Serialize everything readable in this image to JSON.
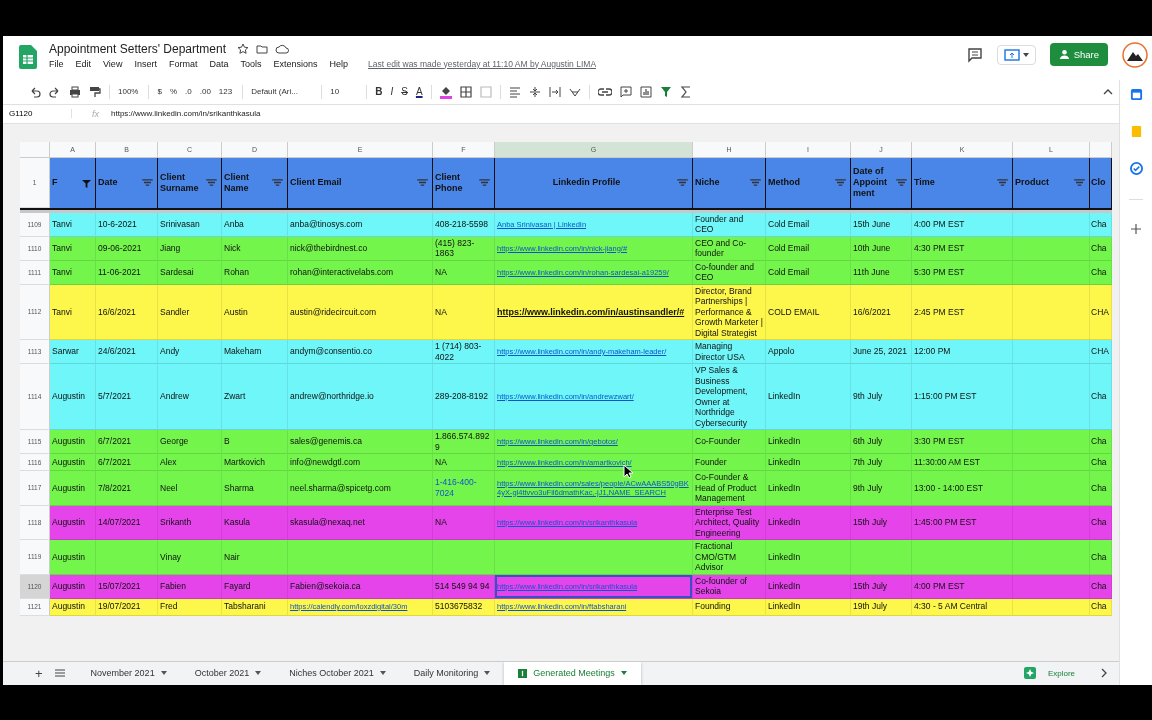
{
  "document": {
    "title": "Appointment Setters' Department",
    "last_edit": "Last edit was made yesterday at 11:10 AM by Augustin LIMA"
  },
  "menu": [
    "File",
    "Edit",
    "View",
    "Insert",
    "Format",
    "Data",
    "Tools",
    "Extensions",
    "Help"
  ],
  "share_button": "Share",
  "toolbar": {
    "zoom": "100%",
    "currency": "$",
    "percent": "%",
    "decrease_decimals": ".0",
    "increase_decimals": ".00",
    "number_format": "123",
    "font": "Default (Ari...",
    "font_size": "10",
    "bold": "B",
    "italic": "I",
    "strikethrough": "S",
    "text_color": "A"
  },
  "formula_bar": {
    "cell": "G1120",
    "fx": "fx",
    "value": "https://www.linkedin.com/in/srikanthkasula"
  },
  "header_row": "1",
  "columns": [
    {
      "letter": "A",
      "header": "F",
      "filter_active": true,
      "selected": false
    },
    {
      "letter": "B",
      "header": "Date",
      "filter_active": false,
      "selected": false
    },
    {
      "letter": "C",
      "header": "Client Surname",
      "filter_active": false,
      "selected": false
    },
    {
      "letter": "D",
      "header": "Client Name",
      "filter_active": false,
      "selected": false
    },
    {
      "letter": "E",
      "header": "Client Email",
      "filter_active": false,
      "selected": false
    },
    {
      "letter": "F",
      "header": "Client Phone",
      "filter_active": false,
      "selected": false
    },
    {
      "letter": "G",
      "header": "Linkedin Profile",
      "filter_active": false,
      "selected": true
    },
    {
      "letter": "H",
      "header": "Niche",
      "filter_active": false,
      "selected": false
    },
    {
      "letter": "I",
      "header": "Method",
      "filter_active": false,
      "selected": false
    },
    {
      "letter": "J",
      "header": "Date of Appoint ment",
      "filter_active": false,
      "selected": false
    },
    {
      "letter": "K",
      "header": "Time",
      "filter_active": false,
      "selected": false
    },
    {
      "letter": "L",
      "header": "Product",
      "filter_active": false,
      "selected": false
    },
    {
      "header": "Clo"
    }
  ],
  "rows": [
    {
      "number": "1109",
      "color": "#6ff6f9",
      "selected": false,
      "cells": [
        "Tanvi",
        "10-6-2021",
        "Srinivasan",
        "Anba",
        "anba@tinosys.com",
        "408-218-5598",
        {
          "text": "Anba Srinivasan | LinkedIn",
          "kind": "link"
        },
        "Founder and CEO",
        "Cold Email",
        "15th June",
        "4:00 PM EST",
        null,
        "Cha"
      ]
    },
    {
      "number": "1110",
      "color": "#74f54c",
      "selected": false,
      "cells": [
        "Tanvi",
        "09-06-2021",
        "Jiang",
        "Nick",
        "nick@thebirdnest.co",
        "(415) 823-1863",
        {
          "text": "https://www.linkedin.com/in/nick-jiang/#",
          "kind": "link"
        },
        "CEO and Co-founder",
        "Cold Email",
        "10th June",
        "4:30 PM EST",
        null,
        "Cha"
      ]
    },
    {
      "number": "1111",
      "color": "#74f54c",
      "selected": false,
      "cells": [
        "Tanvi",
        "11-06-2021",
        "Sardesai",
        "Rohan",
        "rohan@interactivelabs.com",
        "NA",
        {
          "text": "https://www.linkedin.com/in/rohan-sardesai-a19259/",
          "kind": "link"
        },
        "Co-founder and CEO",
        "Cold Email",
        "11th June",
        "5:30 PM EST",
        null,
        "Cha"
      ]
    },
    {
      "number": "1112",
      "color": "#fdf64b",
      "selected": false,
      "cells": [
        "Tanvi",
        "16/6/2021",
        "Sandler",
        "Austin",
        "austin@ridecircuit.com",
        "NA",
        {
          "text": "https://www.linkedin.com/in/austinsandler/#",
          "kind": "bold-link"
        },
        "Director, Brand Partnerships | Performance & Growth Marketer | Digital Strategist",
        "COLD EMAIL",
        "16/6/2021",
        "2:45 PM EST",
        null,
        "CHA"
      ]
    },
    {
      "number": "1113",
      "color": "#6ff6f9",
      "selected": false,
      "cells": [
        "Sarwar",
        "24/6/2021",
        "Andy",
        "Makeham",
        "andym@consentio.co",
        "1 (714) 803-4022",
        {
          "text": "https://www.linkedin.com/in/andy-makeham-leader/",
          "kind": "link"
        },
        "Managing Director USA",
        "Appolo",
        "June 25, 2021",
        "12:00 PM",
        null,
        "CHA"
      ]
    },
    {
      "number": "1114",
      "color": "#6ff6f9",
      "selected": false,
      "cells": [
        "Augustin",
        "5/7/2021",
        "Andrew",
        "Zwart",
        "andrew@northridge.io",
        "289-208-8192",
        {
          "text": "https://www.linkedin.com/in/andrewzwart/",
          "kind": "link"
        },
        "VP Sales & Business Development, Owner at Northridge Cybersecurity",
        "LinkedIn",
        "9th July",
        "1:15:00 PM EST",
        null,
        "Cha"
      ]
    },
    {
      "number": "1115",
      "color": "#74f54c",
      "selected": false,
      "cells": [
        "Augustin",
        "6/7/2021",
        "George",
        "B",
        "sales@genemis.ca",
        "1.866.574.8929",
        {
          "text": "https://www.linkedin.com/in/gebotos/",
          "kind": "link"
        },
        "Co-Founder",
        "LinkedIn",
        "6th July",
        "3:30 PM EST",
        null,
        "Cha"
      ]
    },
    {
      "number": "1116",
      "color": "#74f54c",
      "selected": false,
      "cells": [
        "Augustin",
        "6/7/2021",
        "Alex",
        "Martkovich",
        "info@newdgtl.com",
        "NA",
        {
          "text": "https://www.linkedin.com/in/amartkovich/",
          "kind": "link"
        },
        "Founder",
        "LinkedIn",
        "7th July",
        "11:30:00 AM EST",
        null,
        "Cha"
      ]
    },
    {
      "number": "1117",
      "color": "#74f54c",
      "selected": false,
      "cells": [
        "Augustin",
        "7/8/2021",
        "Neel",
        "Sharma",
        "neel.sharma@spicetg.com",
        {
          "text": "1-416-400-7024",
          "kind": "phone-link"
        },
        {
          "text": "https://www.linkedin.com/sales/people/ACwAAABS50gBK4yX-gl4ttvvo3uFil6dmathKac,-jJ1,NAME_SEARCH",
          "kind": "link"
        },
        "Co-Founder & Head of Product Management",
        "LinkedIn",
        "9th July",
        "13:00 - 14:00 EST",
        null,
        "Cha"
      ]
    },
    {
      "number": "1118",
      "color": "#e444ea",
      "selected": false,
      "cells": [
        "Augustin",
        "14/07/2021",
        "Srikanth",
        "Kasula",
        "skasula@nexaq.net",
        "NA",
        {
          "text": "https://www.linkedin.com/in/srikanthkasula",
          "kind": "link"
        },
        "Enterprise Test Architect, Quality Engineering",
        "LinkedIn",
        "15th July",
        "1:45:00 PM EST",
        null,
        "Cha"
      ]
    },
    {
      "number": "1119",
      "color": "#74f54c",
      "selected": false,
      "cells": [
        "Augustin",
        null,
        "Vinay",
        "Nair",
        null,
        null,
        null,
        "Fractional CMO/GTM Advisor",
        "LinkedIn",
        null,
        null,
        null,
        "Cha"
      ]
    },
    {
      "number": "1120",
      "color": "#e444ea",
      "selected": true,
      "cells": [
        "Augustin",
        "15/07/2021",
        "Fabien",
        "Fayard",
        "Fabien@sekoia.ca",
        "514 549 94 94",
        {
          "text": "https://www.linkedin.com/in/srikanthkasula",
          "kind": "link"
        },
        "Co-founder of Sekoia",
        "LinkedIn",
        "15th July",
        "4:00 PM EST",
        null,
        "Cha"
      ]
    },
    {
      "number": "1121",
      "color": "#fdf64b",
      "selected": false,
      "cells": [
        "Augustin",
        "19/07/2021",
        "Fred",
        "Tabsharani",
        {
          "text": "https://calendly.com/loxzdigital/30m",
          "kind": "link"
        },
        "5103675832",
        {
          "text": "https://www.linkedin.com/in/ftabsharani",
          "kind": "link"
        },
        "Founding",
        "LinkedIn",
        "19th July",
        "4:30 - 5 AM Central",
        null,
        "Cha"
      ]
    }
  ],
  "sheet_tabs": [
    {
      "label": "November 2021",
      "selected": false
    },
    {
      "label": "October 2021",
      "selected": false
    },
    {
      "label": "Niches October 2021",
      "selected": false
    },
    {
      "label": "Daily Monitoring",
      "selected": false
    },
    {
      "label": "Generated Meetings",
      "selected": true
    }
  ],
  "add_sheet": "+",
  "explore_button": "Explore"
}
